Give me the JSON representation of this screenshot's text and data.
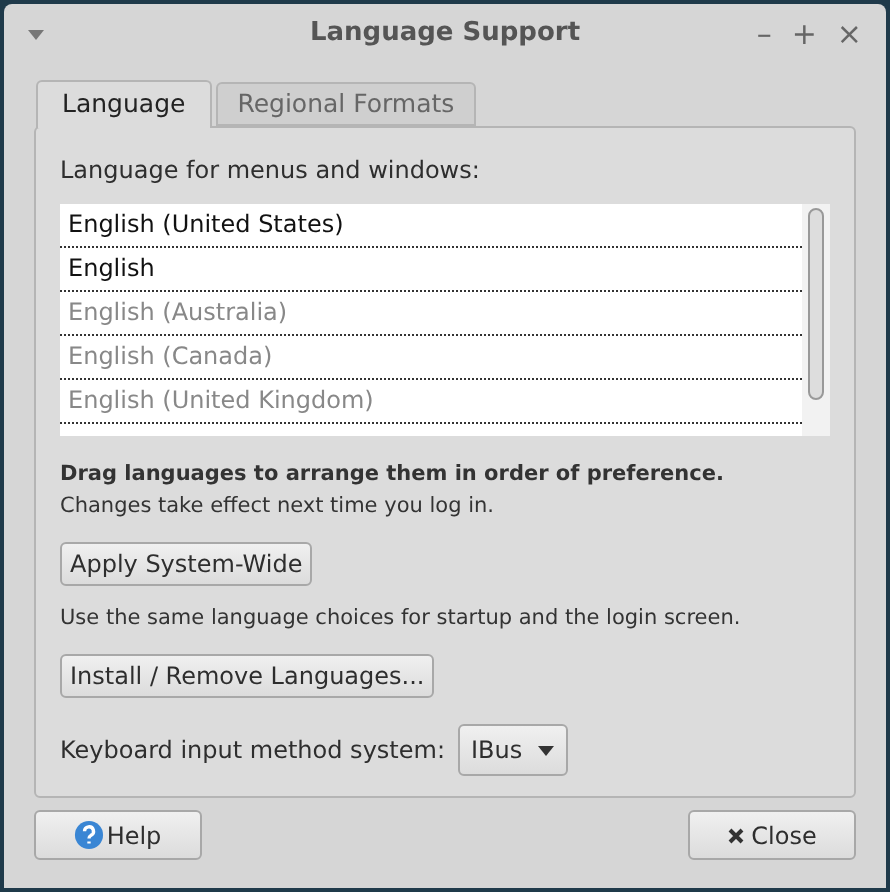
{
  "window": {
    "title": "Language Support",
    "controls": [
      "–",
      "+",
      "×"
    ]
  },
  "tabs": [
    {
      "label": "Language",
      "selected": true
    },
    {
      "label": "Regional Formats",
      "selected": false
    }
  ],
  "language_list": {
    "label": "Language for menus and windows:",
    "items": [
      {
        "name": "English (United States)",
        "disabled": false
      },
      {
        "name": "English",
        "disabled": false
      },
      {
        "name": "English (Australia)",
        "disabled": true
      },
      {
        "name": "English (Canada)",
        "disabled": true
      },
      {
        "name": "English (United Kingdom)",
        "disabled": true
      }
    ]
  },
  "hint": "Drag languages to arrange them in order of preference.",
  "note": "Changes take effect next time you log in.",
  "apply_button": "Apply System-Wide",
  "apply_note": "Use the same language choices for startup and the login screen.",
  "install_button": "Install / Remove Languages...",
  "input_method": {
    "label": "Keyboard input method system:",
    "value": "IBus"
  },
  "buttons": {
    "help": "Help",
    "close": "Close"
  }
}
